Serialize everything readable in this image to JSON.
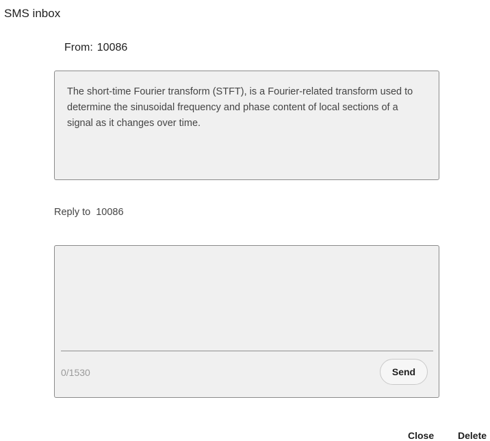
{
  "window": {
    "title": "SMS inbox"
  },
  "message": {
    "from_label": "From:",
    "from_number": "10086",
    "body": "The short-time Fourier transform (STFT), is a Fourier-related transform used to determine the sinusoidal frequency and phase content of local sections of a signal as it changes over time."
  },
  "reply": {
    "label": "Reply to",
    "number": "10086",
    "value": "",
    "counter": "0/1530",
    "send_label": "Send"
  },
  "actions": {
    "close_label": "Close",
    "delete_label": "Delete"
  }
}
